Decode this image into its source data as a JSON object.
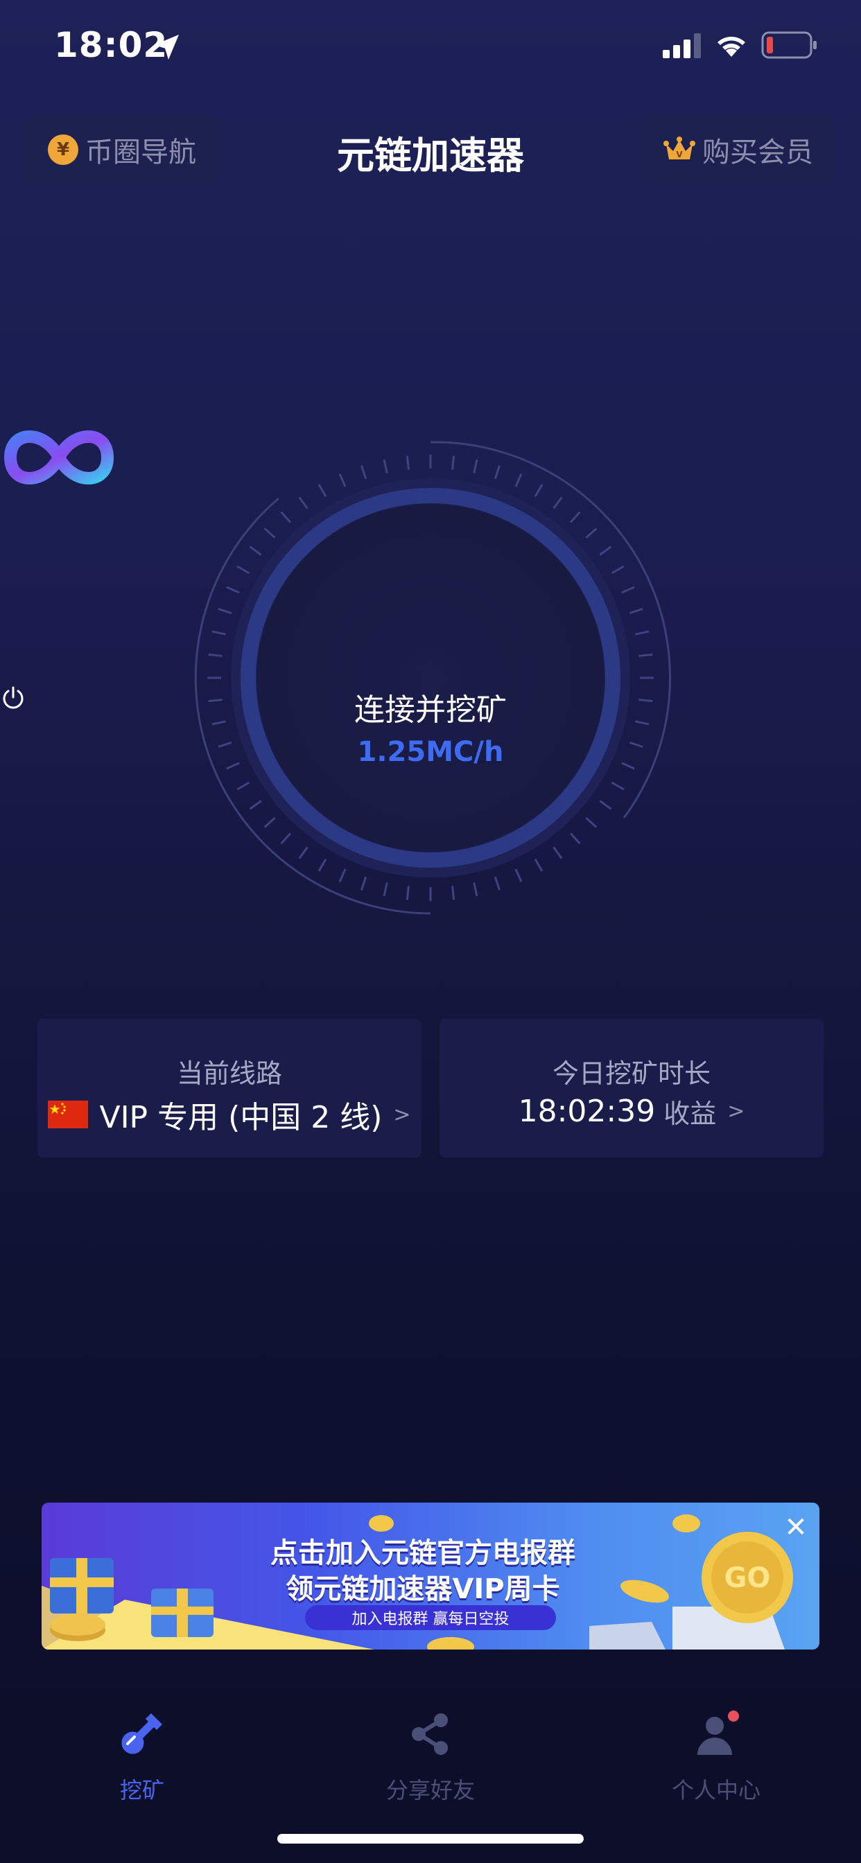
{
  "status_bar": {
    "time": "18:02"
  },
  "header": {
    "title": "元链加速器",
    "nav_button": {
      "label": "币圈导航",
      "coin_glyph": "¥"
    },
    "vip_button": {
      "label": "购买会员"
    }
  },
  "dial": {
    "connect_label": "连接并挖矿",
    "speed": "1.25MC/h",
    "accent_color": "#3d6cf2"
  },
  "cards": {
    "route": {
      "label": "当前线路",
      "value": "VIP 专用 (中国 2 线)",
      "chevron": ">"
    },
    "duration": {
      "label": "今日挖矿时长",
      "value": "18:02:39",
      "earnings_label": "收益",
      "chevron": ">"
    }
  },
  "banner": {
    "line1": "点击加入元链官方电报群",
    "line2": "领元链加速器VIP周卡",
    "pill": "加入电报群 赢每日空投",
    "badge": "GO",
    "close_glyph": "✕"
  },
  "tabs": [
    {
      "label": "挖矿",
      "icon": "shovel-icon",
      "active": true
    },
    {
      "label": "分享好友",
      "icon": "share-icon",
      "active": false
    },
    {
      "label": "个人中心",
      "icon": "person-icon",
      "active": false,
      "badge_dot": true
    }
  ],
  "colors": {
    "active_tab": "#4a64f0",
    "inactive_tab": "#4a4f78",
    "notification_dot": "#e8505b"
  }
}
